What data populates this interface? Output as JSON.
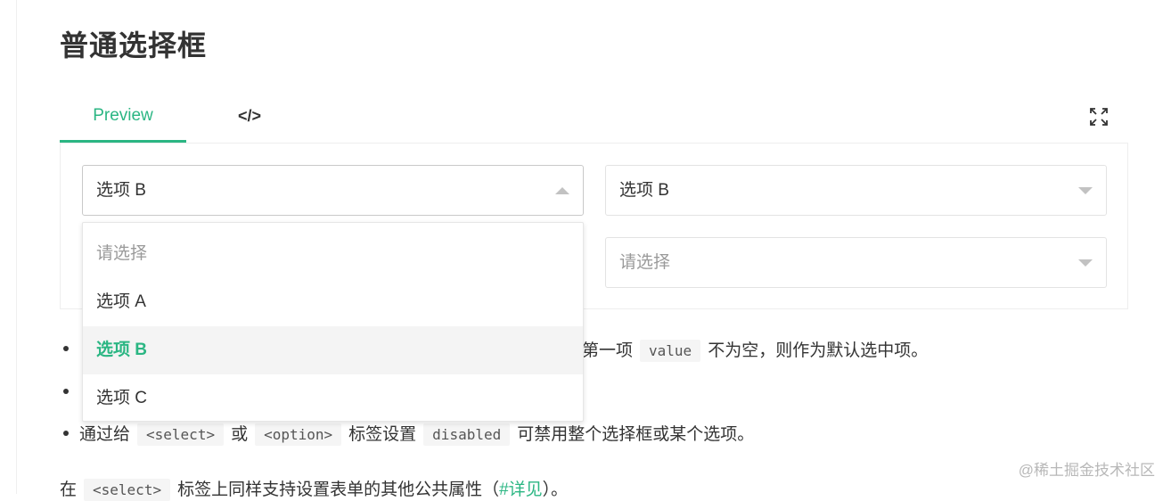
{
  "title": "普通选择框",
  "tabs": [
    {
      "label": "Preview",
      "active": true
    },
    {
      "label": "</>",
      "active": false
    }
  ],
  "icons": {
    "fullscreen": "fullscreen-icon"
  },
  "selects": [
    {
      "value": "选项 B",
      "is_placeholder": false,
      "open": true
    },
    {
      "value": "选项 B",
      "is_placeholder": false,
      "open": false
    },
    {
      "value": "请选择",
      "is_placeholder": true,
      "open": false
    }
  ],
  "dropdown": {
    "options": [
      "请选择",
      "选项 A",
      "选项 B",
      "选项 C"
    ],
    "selected_index": 2
  },
  "descriptions": {
    "line1": {
      "text_before": "第一项",
      "code": "value",
      "text_after": "不为空，则作为默认选中项。"
    },
    "line3": {
      "text_1": "通过给",
      "code_1": "<select>",
      "text_2": "或",
      "code_2": "<option>",
      "text_3": "标签设置",
      "code_3": "disabled",
      "text_4": "可禁用整个选择框或某个选项。"
    },
    "line4": {
      "text_1": "在",
      "code_1": "<select>",
      "text_2": "标签上同样支持设置表单的其他公共属性（",
      "link": "#详见",
      "text_3": "）。"
    }
  },
  "watermark": "@稀土掘金技术社区",
  "colors": {
    "accent": "#2bb683",
    "text": "#333333",
    "placeholder": "#9a9a9a"
  }
}
